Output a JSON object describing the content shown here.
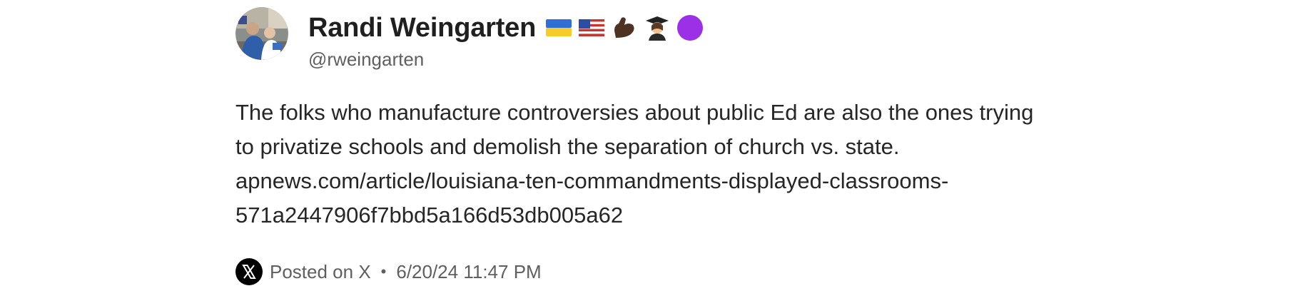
{
  "author": {
    "display_name": "Randi Weingarten",
    "handle": "@rweingarten",
    "avatar_icon": "avatar-photo",
    "name_emojis": [
      "ukraine-flag-icon",
      "us-flag-icon",
      "flexed-biceps-icon",
      "student-icon",
      "purple-circle-icon"
    ]
  },
  "post": {
    "lines": [
      "The folks who manufacture controversies about public Ed are also the ones trying",
      "to privatize schools and demolish the separation of church vs. state."
    ],
    "link_lines": [
      "apnews.com/article/louisiana-ten-commandments-displayed-classrooms-",
      "571a2447906f7bbd5a166d53db005a62"
    ]
  },
  "footer": {
    "platform_icon": "x-logo-icon",
    "posted_on": "Posted on X",
    "separator": "•",
    "timestamp": "6/20/24 11:47 PM"
  },
  "colors": {
    "name": "#1f1f1f",
    "text": "#262626",
    "muted": "#5f5f5f"
  }
}
